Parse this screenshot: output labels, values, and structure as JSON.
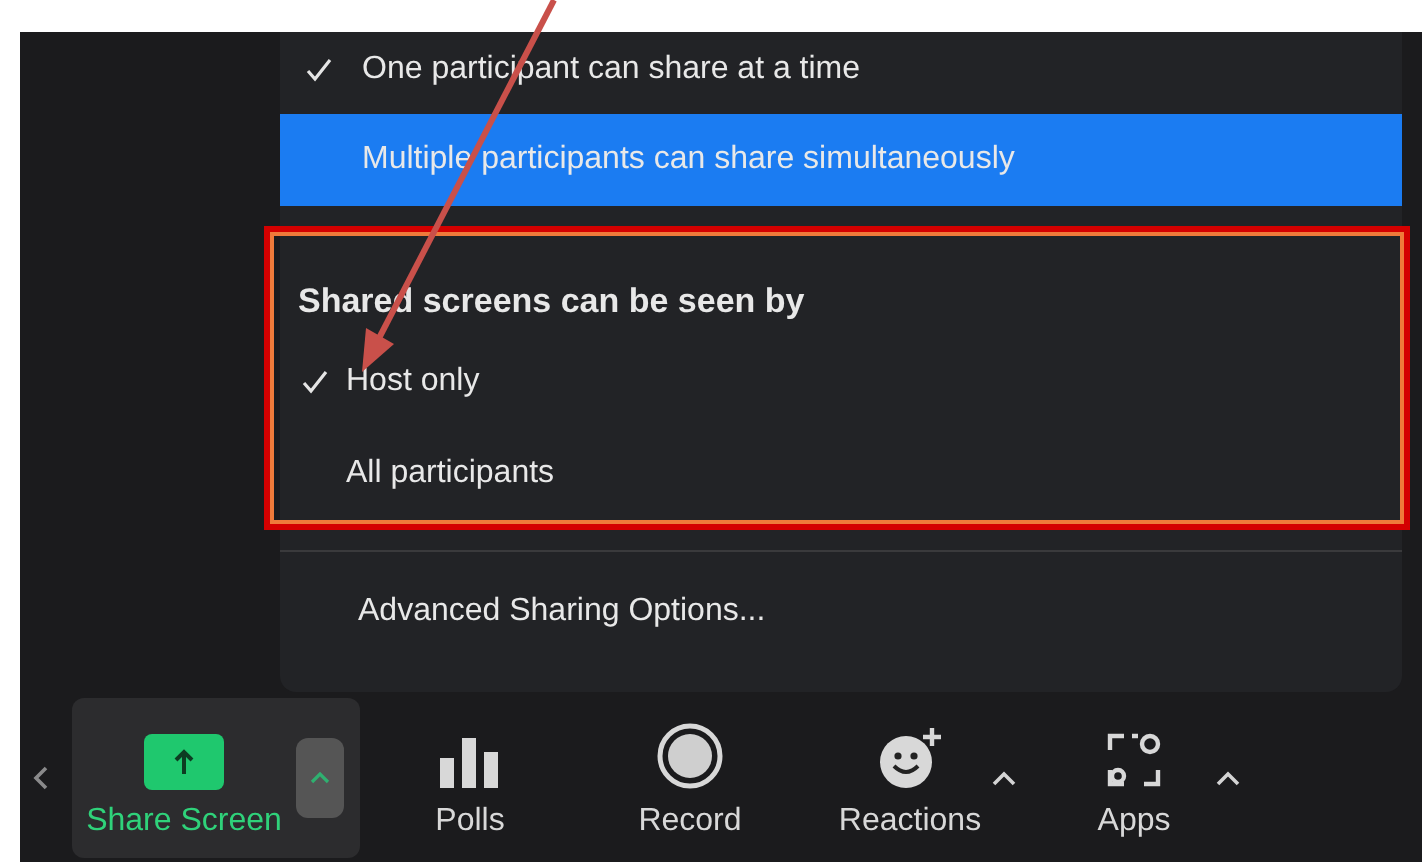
{
  "share_menu": {
    "sharing_options": [
      {
        "label": "One participant can share at a time",
        "checked": true,
        "highlighted": false
      },
      {
        "label": "Multiple participants can share simultaneously",
        "checked": false,
        "highlighted": true
      }
    ],
    "viewers": {
      "title": "Shared screens can be seen by",
      "options": [
        {
          "label": "Host only",
          "checked": true
        },
        {
          "label": "All participants",
          "checked": false
        }
      ]
    },
    "advanced": "Advanced Sharing Options..."
  },
  "toolbar": [
    {
      "kind": "share",
      "label": "Share Screen",
      "active": true
    },
    {
      "kind": "polls",
      "label": "Polls",
      "active": false
    },
    {
      "kind": "record",
      "label": "Record",
      "active": false
    },
    {
      "kind": "reactions",
      "label": "Reactions",
      "active": false
    },
    {
      "kind": "apps",
      "label": "Apps",
      "active": false
    }
  ]
}
